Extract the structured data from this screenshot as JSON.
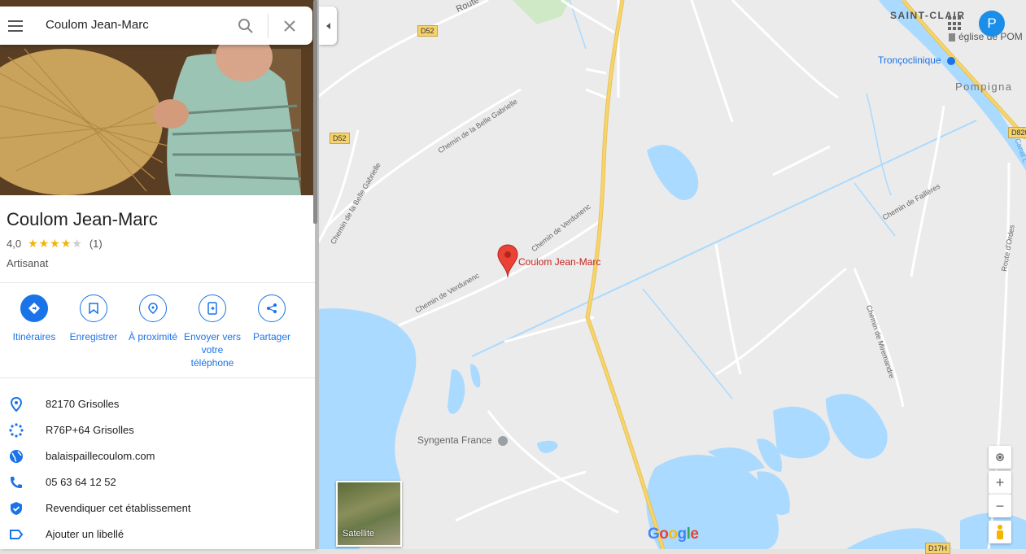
{
  "search": {
    "value": "Coulom Jean-Marc"
  },
  "place": {
    "name": "Coulom Jean-Marc",
    "rating": "4,0",
    "stars_filled": 4,
    "stars_total": 5,
    "review_count": "(1)",
    "category": "Artisanat"
  },
  "actions": [
    {
      "label": "Itinéraires",
      "icon": "directions-icon"
    },
    {
      "label": "Enregistrer",
      "icon": "bookmark-icon"
    },
    {
      "label": "À proximité",
      "icon": "nearby-icon"
    },
    {
      "label": "Envoyer vers votre téléphone",
      "icon": "send-to-phone-icon"
    },
    {
      "label": "Partager",
      "icon": "share-icon"
    }
  ],
  "info": [
    {
      "text": "82170 Grisolles",
      "icon": "location-pin-icon"
    },
    {
      "text": "R76P+64 Grisolles",
      "icon": "plus-code-icon"
    },
    {
      "text": "balaispaillecoulom.com",
      "icon": "globe-icon"
    },
    {
      "text": "05 63 64 12 52",
      "icon": "phone-icon"
    },
    {
      "text": "Revendiquer cet établissement",
      "icon": "verified-shield-icon"
    },
    {
      "text": "Ajouter un libellé",
      "icon": "label-icon"
    }
  ],
  "map": {
    "marker_label": "Coulom Jean-Marc",
    "poi_syngenta": "Syngenta France",
    "poi_troncoclinique": "Tronçoclinique",
    "poi_eglise": "église de POM",
    "place_saint_clair": "SAINT-CLAIR",
    "place_pompignan": "Pompigna",
    "road_d52_a": "D52",
    "road_d52_b": "D52",
    "road_d820": "D820",
    "road_d17h": "D17H",
    "road_route": "Route",
    "road_chemin_belle_gabrielle": "Chemin de la Belle Gabrielle",
    "road_chemin_belle_gabrielle_2": "Chemin de la Belle Gabrielle",
    "road_chemin_verdunenc_a": "Chemin de Verdunenc",
    "road_chemin_verdunenc_b": "Chemin de Verdunenc",
    "road_chemin_faillieres": "Chemin de Faillères",
    "road_chemin_miremandre": "Chemin de Miremandre",
    "road_route_ordes": "Route d'Ordes",
    "canal_label": "Canal L",
    "satellite_label": "Satellite",
    "avatar_initial": "P",
    "google_logo": "Google",
    "zoom_in": "+",
    "zoom_out": "−"
  },
  "colors": {
    "accent": "#1a73e8",
    "water": "#aadaff",
    "land": "#e8e8e8",
    "road_major": "#f7d56b",
    "marker": "#ea4335"
  }
}
